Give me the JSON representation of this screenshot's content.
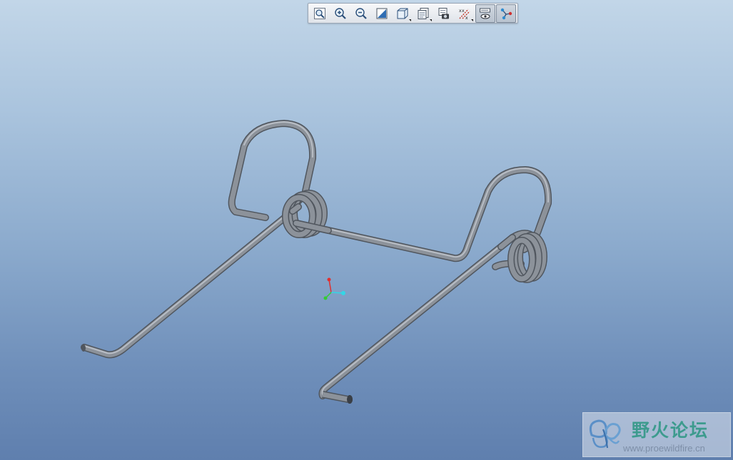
{
  "toolbar": {
    "buttons": [
      {
        "icon": "zoom-fit-icon"
      },
      {
        "icon": "zoom-in-icon"
      },
      {
        "icon": "zoom-out-icon"
      },
      {
        "icon": "repaint-icon"
      },
      {
        "icon": "display-style-icon",
        "flyout": true
      },
      {
        "icon": "saved-views-icon",
        "flyout": true
      },
      {
        "icon": "view-manager-icon"
      },
      {
        "icon": "datum-display-icon",
        "flyout": true
      },
      {
        "icon": "spin-center-icon",
        "active": true
      },
      {
        "icon": "annotation-display-icon",
        "active": true
      }
    ]
  },
  "colors": {
    "background_top": "#c2d6e8",
    "background_bottom": "#5f7fae",
    "wire": "#8a9099",
    "axis_x": "#33d6e6",
    "axis_y": "#e03030",
    "axis_z": "#33cc33"
  },
  "watermark": {
    "title": "野火论坛",
    "url": "www.proewildfire.cn"
  }
}
